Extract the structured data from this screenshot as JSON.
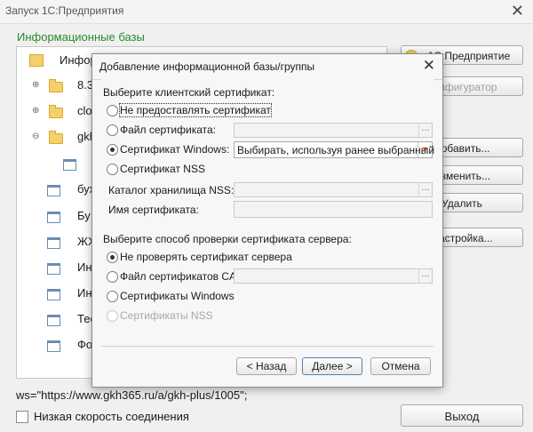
{
  "window": {
    "title": "Запуск 1С:Предприятия",
    "close": "✕"
  },
  "infobases": {
    "section_label": "Информационные базы",
    "items": [
      "Инфор",
      "8.3",
      "clo",
      "gkh",
      "",
      "бух",
      "Бу",
      "ЖХ",
      "Ин",
      "Ин",
      "Тес",
      "Фо"
    ]
  },
  "side_buttons": {
    "enterprise": "1С:Предприятие",
    "configurator": "Конфигуратор",
    "add": "Добавить...",
    "change": "Изменить...",
    "delete": "Удалить",
    "settings": "Настройка..."
  },
  "connection_string": "ws=\"https://www.gkh365.ru/a/gkh-plus/1005\";",
  "low_speed": {
    "label": "Низкая скорость соединения",
    "checked": false
  },
  "exit_button": "Выход",
  "dialog": {
    "title": "Добавление информационной базы/группы",
    "close": "✕",
    "client_cert_header": "Выберите клиентский сертификат:",
    "client_options": [
      {
        "label": "Не предоставлять сертификат",
        "selected": false
      },
      {
        "label": "Файл сертификата:",
        "selected": false
      },
      {
        "label": "Сертификат Windows:",
        "selected": true
      },
      {
        "label": "Сертификат NSS",
        "selected": false
      }
    ],
    "windows_cert_value": "Выбирать, используя ранее выбранный",
    "nss_catalog_label": "Каталог хранилища NSS:",
    "cert_name_label": "Имя сертификата:",
    "server_check_header": "Выберите способ проверки сертификата сервера:",
    "server_options": [
      {
        "label": "Не проверять сертификат сервера",
        "selected": true,
        "disabled": false
      },
      {
        "label": "Файл сертификатов CA:",
        "selected": false,
        "disabled": false
      },
      {
        "label": "Сертификаты Windows",
        "selected": false,
        "disabled": false
      },
      {
        "label": "Сертификаты NSS",
        "selected": false,
        "disabled": true
      }
    ],
    "back_button": "< Назад",
    "next_button": "Далее >",
    "cancel_button": "Отмена",
    "dots": "..."
  }
}
